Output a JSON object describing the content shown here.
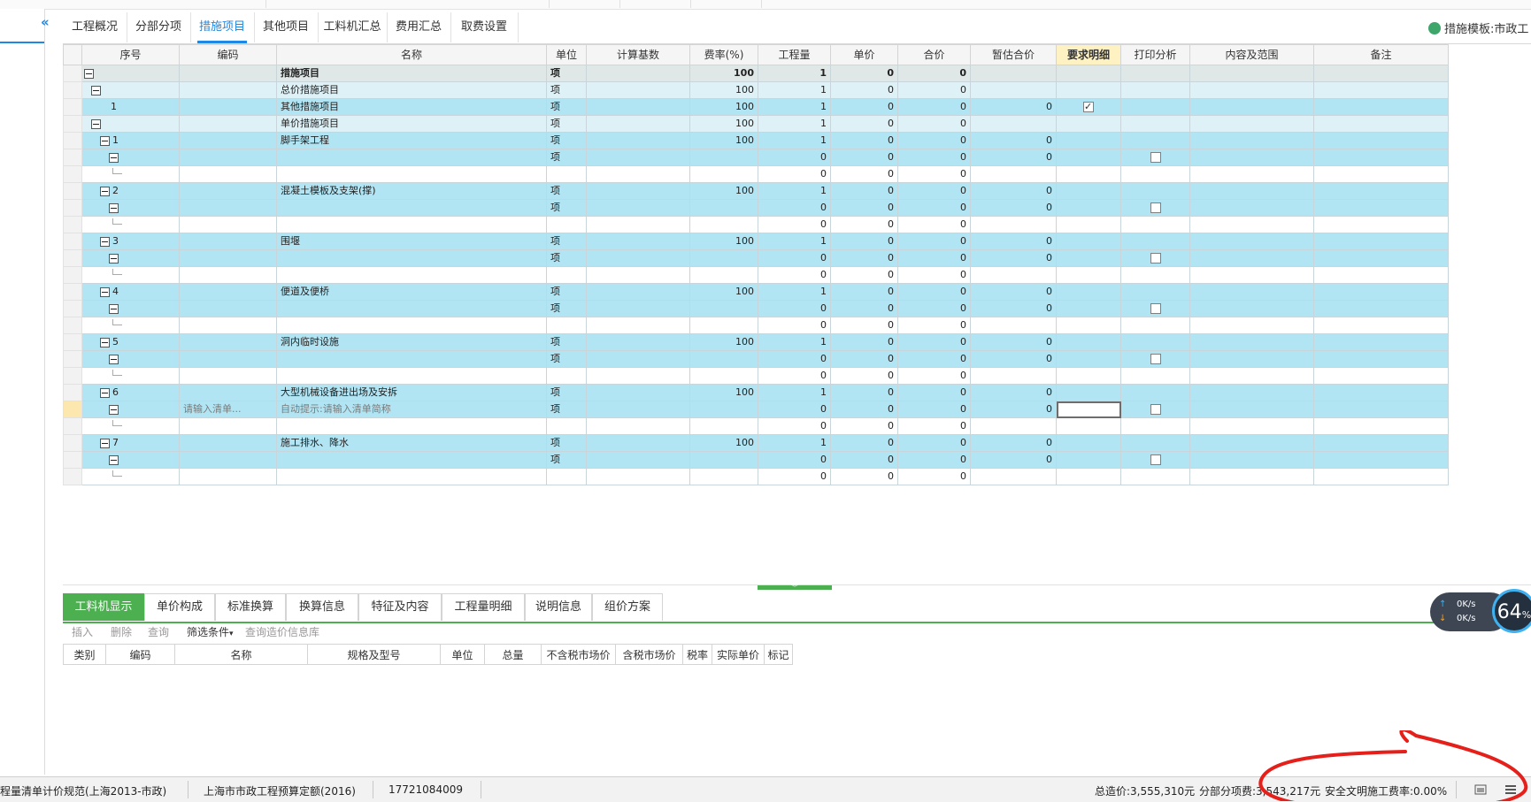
{
  "tabs": [
    {
      "label": "工程概况",
      "active": false
    },
    {
      "label": "分部分项",
      "active": false
    },
    {
      "label": "措施项目",
      "active": true
    },
    {
      "label": "其他项目",
      "active": false
    },
    {
      "label": "工料机汇总",
      "active": false
    },
    {
      "label": "费用汇总",
      "active": false
    },
    {
      "label": "取费设置",
      "active": false
    }
  ],
  "template_label": "措施模板:市政工",
  "columns": [
    "序号",
    "编码",
    "名称",
    "单位",
    "计算基数",
    "费率(%)",
    "工程量",
    "单价",
    "合价",
    "暂估合价",
    "要求明细",
    "打印分析",
    "内容及范围",
    "备注"
  ],
  "rows": [
    {
      "seq": "",
      "code": "",
      "name": "措施项目",
      "unit": "项",
      "base": "",
      "rate": "100",
      "qty": "1",
      "price": "0",
      "total": "0",
      "est": "",
      "detail": "",
      "print": ""
    },
    {
      "seq": "",
      "code": "",
      "name": "总价措施项目",
      "unit": "项",
      "base": "",
      "rate": "100",
      "qty": "1",
      "price": "0",
      "total": "0",
      "est": "",
      "detail": "",
      "print": ""
    },
    {
      "seq": "1",
      "code": "",
      "name": "其他措施项目",
      "unit": "项",
      "base": "",
      "rate": "100",
      "qty": "1",
      "price": "0",
      "total": "0",
      "est": "0",
      "detail": "checked",
      "print": ""
    },
    {
      "seq": "",
      "code": "",
      "name": "单价措施项目",
      "unit": "项",
      "base": "",
      "rate": "100",
      "qty": "1",
      "price": "0",
      "total": "0",
      "est": "",
      "detail": "",
      "print": ""
    },
    {
      "seq": "1",
      "code": "",
      "name": "脚手架工程",
      "unit": "项",
      "base": "",
      "rate": "100",
      "qty": "1",
      "price": "0",
      "total": "0",
      "est": "0",
      "detail": "",
      "print": ""
    },
    {
      "seq": "",
      "code": "",
      "name": "",
      "unit": "项",
      "base": "",
      "rate": "",
      "qty": "0",
      "price": "0",
      "total": "0",
      "est": "0",
      "detail": "",
      "print": "unchecked"
    },
    {
      "seq": "",
      "code": "",
      "name": "",
      "unit": "",
      "base": "",
      "rate": "",
      "qty": "0",
      "price": "0",
      "total": "0",
      "est": "",
      "detail": "",
      "print": ""
    },
    {
      "seq": "2",
      "code": "",
      "name": "混凝土模板及支架(撑)",
      "unit": "项",
      "base": "",
      "rate": "100",
      "qty": "1",
      "price": "0",
      "total": "0",
      "est": "0",
      "detail": "",
      "print": ""
    },
    {
      "seq": "",
      "code": "",
      "name": "",
      "unit": "项",
      "base": "",
      "rate": "",
      "qty": "0",
      "price": "0",
      "total": "0",
      "est": "0",
      "detail": "",
      "print": "unchecked"
    },
    {
      "seq": "",
      "code": "",
      "name": "",
      "unit": "",
      "base": "",
      "rate": "",
      "qty": "0",
      "price": "0",
      "total": "0",
      "est": "",
      "detail": "",
      "print": ""
    },
    {
      "seq": "3",
      "code": "",
      "name": "围堰",
      "unit": "项",
      "base": "",
      "rate": "100",
      "qty": "1",
      "price": "0",
      "total": "0",
      "est": "0",
      "detail": "",
      "print": ""
    },
    {
      "seq": "",
      "code": "",
      "name": "",
      "unit": "项",
      "base": "",
      "rate": "",
      "qty": "0",
      "price": "0",
      "total": "0",
      "est": "0",
      "detail": "",
      "print": "unchecked"
    },
    {
      "seq": "",
      "code": "",
      "name": "",
      "unit": "",
      "base": "",
      "rate": "",
      "qty": "0",
      "price": "0",
      "total": "0",
      "est": "",
      "detail": "",
      "print": ""
    },
    {
      "seq": "4",
      "code": "",
      "name": "便道及便桥",
      "unit": "项",
      "base": "",
      "rate": "100",
      "qty": "1",
      "price": "0",
      "total": "0",
      "est": "0",
      "detail": "",
      "print": ""
    },
    {
      "seq": "",
      "code": "",
      "name": "",
      "unit": "项",
      "base": "",
      "rate": "",
      "qty": "0",
      "price": "0",
      "total": "0",
      "est": "0",
      "detail": "",
      "print": "unchecked"
    },
    {
      "seq": "",
      "code": "",
      "name": "",
      "unit": "",
      "base": "",
      "rate": "",
      "qty": "0",
      "price": "0",
      "total": "0",
      "est": "",
      "detail": "",
      "print": ""
    },
    {
      "seq": "5",
      "code": "",
      "name": "洞内临时设施",
      "unit": "项",
      "base": "",
      "rate": "100",
      "qty": "1",
      "price": "0",
      "total": "0",
      "est": "0",
      "detail": "",
      "print": ""
    },
    {
      "seq": "",
      "code": "",
      "name": "",
      "unit": "项",
      "base": "",
      "rate": "",
      "qty": "0",
      "price": "0",
      "total": "0",
      "est": "0",
      "detail": "",
      "print": "unchecked"
    },
    {
      "seq": "",
      "code": "",
      "name": "",
      "unit": "",
      "base": "",
      "rate": "",
      "qty": "0",
      "price": "0",
      "total": "0",
      "est": "",
      "detail": "",
      "print": ""
    },
    {
      "seq": "6",
      "code": "",
      "name": "大型机械设备进出场及安拆",
      "unit": "项",
      "base": "",
      "rate": "100",
      "qty": "1",
      "price": "0",
      "total": "0",
      "est": "0",
      "detail": "",
      "print": ""
    },
    {
      "seq": "",
      "code": "请输入清单...",
      "name": "自动提示:请输入清单简称",
      "unit": "项",
      "base": "",
      "rate": "",
      "qty": "0",
      "price": "0",
      "total": "0",
      "est": "0",
      "detail": "",
      "print": "unchecked"
    },
    {
      "seq": "",
      "code": "",
      "name": "",
      "unit": "",
      "base": "",
      "rate": "",
      "qty": "0",
      "price": "0",
      "total": "0",
      "est": "",
      "detail": "",
      "print": ""
    },
    {
      "seq": "7",
      "code": "",
      "name": "施工排水、降水",
      "unit": "项",
      "base": "",
      "rate": "100",
      "qty": "1",
      "price": "0",
      "total": "0",
      "est": "0",
      "detail": "",
      "print": ""
    },
    {
      "seq": "",
      "code": "",
      "name": "",
      "unit": "项",
      "base": "",
      "rate": "",
      "qty": "0",
      "price": "0",
      "total": "0",
      "est": "0",
      "detail": "",
      "print": "unchecked"
    },
    {
      "seq": "",
      "code": "",
      "name": "",
      "unit": "",
      "base": "",
      "rate": "",
      "qty": "0",
      "price": "0",
      "total": "0",
      "est": "",
      "detail": "",
      "print": ""
    }
  ],
  "bottom_tabs": [
    {
      "label": "工料机显示",
      "active": true
    },
    {
      "label": "单价构成",
      "active": false
    },
    {
      "label": "标准换算",
      "active": false
    },
    {
      "label": "换算信息",
      "active": false
    },
    {
      "label": "特征及内容",
      "active": false
    },
    {
      "label": "工程量明细",
      "active": false
    },
    {
      "label": "说明信息",
      "active": false
    },
    {
      "label": "组价方案",
      "active": false
    }
  ],
  "toolbar": {
    "insert": "插入",
    "delete": "删除",
    "query": "查询",
    "filter": "筛选条件",
    "query_price": "查询造价信息库"
  },
  "resource_columns": [
    "类别",
    "编码",
    "名称",
    "规格及型号",
    "单位",
    "总量",
    "不含税市场价",
    "含税市场价",
    "税率",
    "实际单价",
    "标记"
  ],
  "status": {
    "norm": "程量清单计价规范(上海2013-市政)",
    "quota": "上海市市政工程预算定额(2016)",
    "id": "17721084009",
    "total": "总造价:3,555,310元",
    "subitem": "分部分项费:3,543,217元",
    "safety": "安全文明施工费率:0.00%"
  },
  "net": {
    "up": "0K/s",
    "down": "0K/s",
    "cpu": "64",
    "cpu_unit": "%"
  }
}
